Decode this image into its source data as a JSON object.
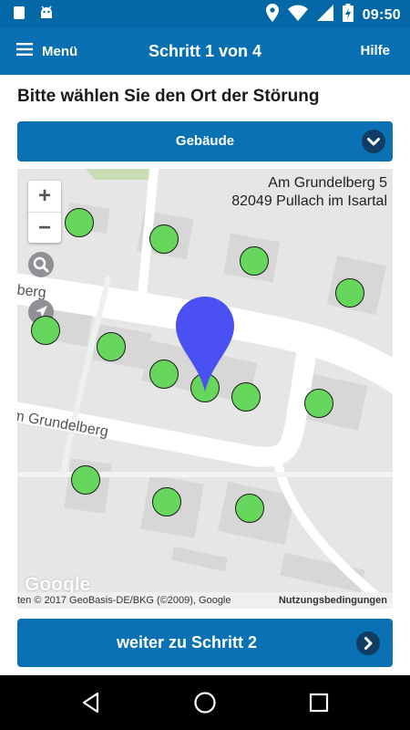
{
  "status_bar": {
    "time": "09:50",
    "icons": [
      "notification-square-icon",
      "android-icon",
      "location-icon",
      "wifi-icon",
      "signal-icon",
      "battery-charging-icon"
    ]
  },
  "app_bar": {
    "menu_label": "Menü",
    "title": "Schritt 1 von 4",
    "help_label": "Hilfe"
  },
  "main": {
    "heading": "Bitte wählen Sie den Ort der Störung",
    "location_type_dropdown": {
      "selected": "Gebäude"
    },
    "map": {
      "address_line1": "Am Grundelberg 5",
      "address_line2": "82049 Pullach im Isartal",
      "street_label_top": "lberg",
      "street_label_mid": "m Grundelberg",
      "zoom_in": "+",
      "zoom_out": "−",
      "google_logo": "Google",
      "attribution": "ten © 2017 GeoBasis-DE/BKG (©2009), Google",
      "terms_label": "Nutzungsbedingungen",
      "marker_color": "#66d65c",
      "pin_color": "#4a50f2"
    },
    "next_button_label": "weiter zu Schritt 2"
  },
  "colors": {
    "status_bar": "#0568a6",
    "app_bar": "#0870b2",
    "button": "#0a72b4",
    "chevron_circle": "#0f3d63"
  }
}
